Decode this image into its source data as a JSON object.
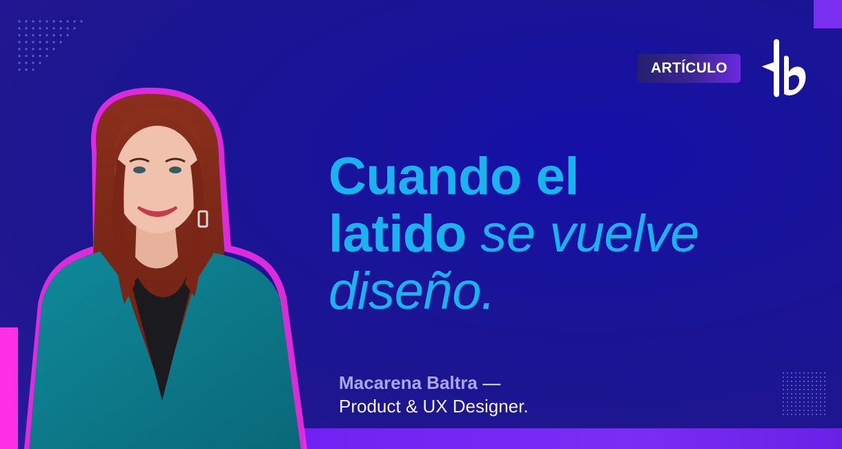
{
  "badge": {
    "label": "ARTÍCULO"
  },
  "logo": {
    "icon": "brand-logo-icon"
  },
  "headline": {
    "line1": "Cuando el",
    "line2_bold": "latido",
    "line2_light": "se vuelve",
    "line3": "diseño."
  },
  "author": {
    "name": "Macarena Baltra",
    "dash": "—",
    "role": "Product & UX Designer."
  },
  "colors": {
    "background": "#1a1496",
    "accent_cyan": "#19b3ef",
    "accent_magenta": "#ff2fe8",
    "accent_purple": "#7b2ff0"
  }
}
